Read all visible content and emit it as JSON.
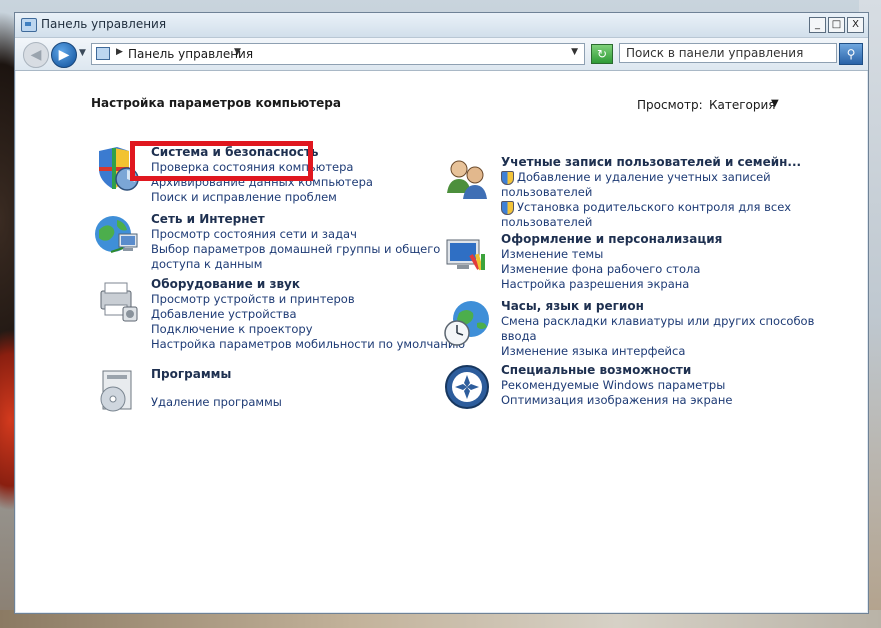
{
  "window": {
    "title": "Панель управления",
    "buttons": {
      "minimize": "_",
      "maximize": "□",
      "close": "X"
    }
  },
  "addressbar": {
    "path": "Панель управления",
    "search_placeholder": "Поиск в панели управления"
  },
  "header": {
    "heading": "Настройка параметров компьютера",
    "view_label": "Просмотр:",
    "view_value": "Категория"
  },
  "categories": {
    "system": {
      "title": "Система и безопасность",
      "links": [
        "Проверка состояния компьютера",
        "Архивирование данных компьютера",
        "Поиск и исправление проблем"
      ]
    },
    "network": {
      "title": "Сеть и Интернет",
      "links": [
        "Просмотр состояния сети и задач",
        "Выбор параметров домашней группы и общего",
        "доступа к данным"
      ]
    },
    "hardware": {
      "title": "Оборудование и звук",
      "links": [
        "Просмотр устройств и принтеров",
        "Добавление устройства",
        "Подключение к проектору",
        "Настройка параметров мобильности по умолчанию"
      ]
    },
    "programs": {
      "title": "Программы",
      "links": [
        "Удаление программы"
      ]
    },
    "accounts": {
      "title": "Учетные записи пользователей и семейн...",
      "links": [
        "Добавление и удаление учетных записей",
        "пользователей",
        "Установка родительского контроля для всех",
        "пользователей"
      ]
    },
    "appearance": {
      "title": "Оформление и персонализация",
      "links": [
        "Изменение темы",
        "Изменение фона рабочего стола",
        "Настройка разрешения экрана"
      ]
    },
    "clock": {
      "title": "Часы, язык и регион",
      "links": [
        "Смена раскладки клавиатуры или других способов",
        "ввода",
        "Изменение языка интерфейса"
      ]
    },
    "ease": {
      "title": "Специальные возможности",
      "links": [
        "Рекомендуемые Windows параметры",
        "Оптимизация изображения на экране"
      ]
    }
  },
  "icons": {
    "system": "shield-icon",
    "network": "globe-network-icon",
    "hardware": "printer-icon",
    "programs": "programs-disc-icon",
    "accounts": "users-icon",
    "appearance": "monitor-palette-icon",
    "clock": "globe-clock-icon",
    "ease": "ease-of-access-icon"
  },
  "colors": {
    "link": "#1e3b75",
    "title": "#1e3050",
    "highlight": "#e0171f"
  }
}
